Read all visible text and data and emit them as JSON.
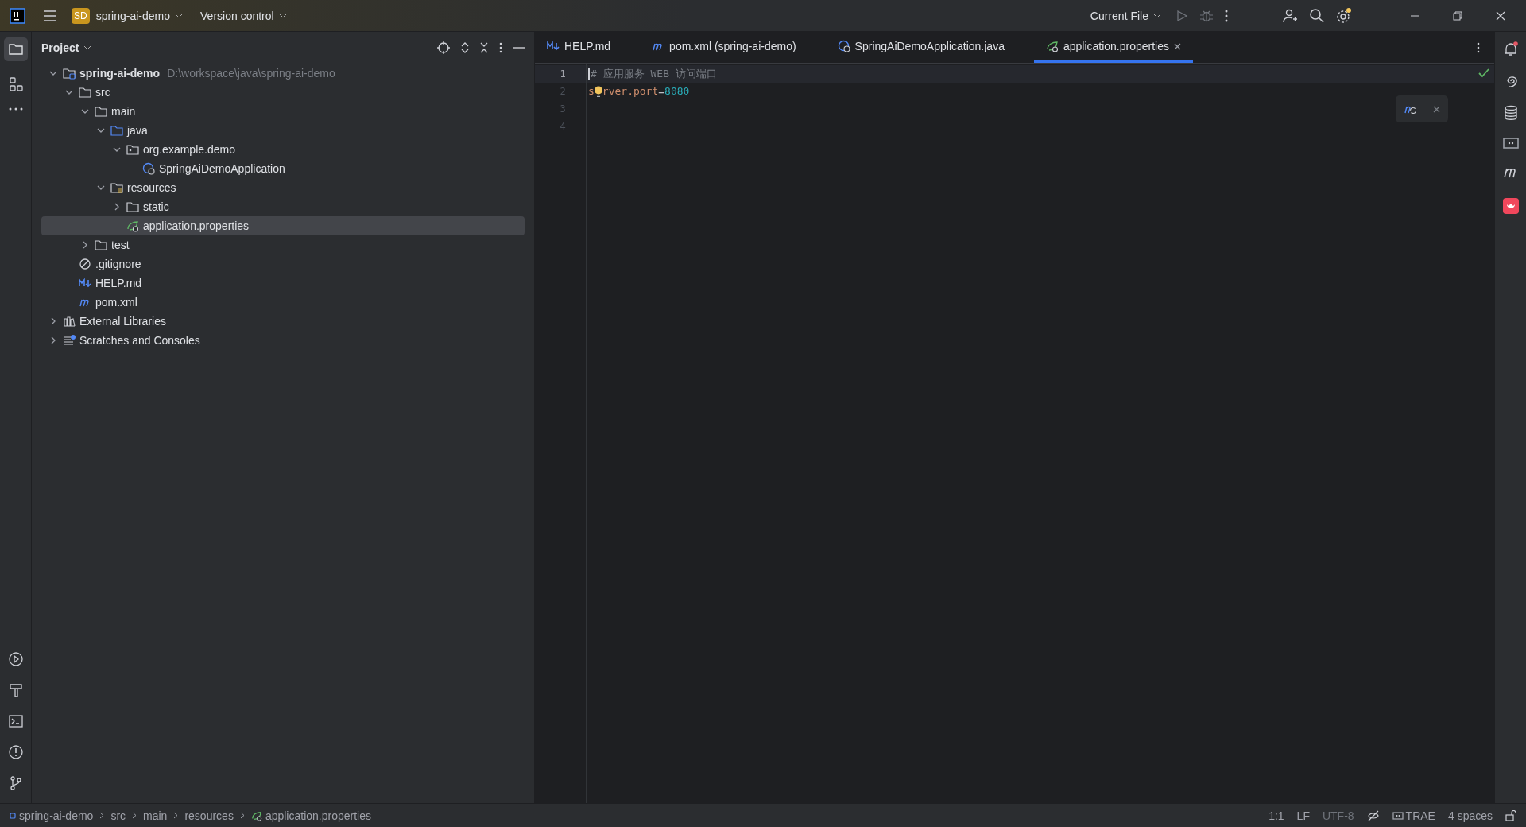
{
  "title_bar": {
    "project_badge": "SD",
    "project_name": "spring-ai-demo",
    "vcs_menu": "Version control",
    "run_config": "Current File"
  },
  "project_panel": {
    "title": "Project",
    "tree": [
      {
        "kind": "project",
        "label": "spring-ai-demo",
        "path": "D:\\workspace\\java\\spring-ai-demo",
        "expanded": true,
        "selected": false,
        "children": [
          {
            "kind": "folder",
            "label": "src",
            "expanded": true,
            "selected": false,
            "children": [
              {
                "kind": "folder",
                "label": "main",
                "expanded": true,
                "selected": false,
                "children": [
                  {
                    "kind": "source-folder",
                    "label": "java",
                    "expanded": true,
                    "selected": false,
                    "children": [
                      {
                        "kind": "package",
                        "label": "org.example.demo",
                        "expanded": true,
                        "selected": false,
                        "children": [
                          {
                            "kind": "class",
                            "label": "SpringAiDemoApplication",
                            "selected": false
                          }
                        ]
                      }
                    ]
                  },
                  {
                    "kind": "resources-folder",
                    "label": "resources",
                    "expanded": true,
                    "selected": false,
                    "children": [
                      {
                        "kind": "folder",
                        "label": "static",
                        "expanded": false,
                        "selected": false
                      },
                      {
                        "kind": "properties",
                        "label": "application.properties",
                        "selected": true
                      }
                    ]
                  }
                ]
              },
              {
                "kind": "folder",
                "label": "test",
                "expanded": false,
                "selected": false
              }
            ]
          },
          {
            "kind": "ignore",
            "label": ".gitignore",
            "selected": false
          },
          {
            "kind": "markdown",
            "label": "HELP.md",
            "selected": false
          },
          {
            "kind": "maven",
            "label": "pom.xml",
            "selected": false
          }
        ]
      },
      {
        "kind": "libraries",
        "label": "External Libraries",
        "expanded": false,
        "selected": false
      },
      {
        "kind": "scratches",
        "label": "Scratches and Consoles",
        "expanded": false,
        "selected": false
      }
    ]
  },
  "editor": {
    "tabs": [
      {
        "kind": "markdown",
        "label": "HELP.md",
        "selected": false
      },
      {
        "kind": "maven",
        "label": "pom.xml (spring-ai-demo)",
        "selected": false
      },
      {
        "kind": "class",
        "label": "SpringAiDemoApplication.java",
        "selected": false
      },
      {
        "kind": "properties",
        "label": "application.properties",
        "selected": true
      }
    ],
    "lines": [
      {
        "number": "1",
        "current": true,
        "parts": [
          {
            "kind": "comment",
            "text": "# 应用服务 WEB 访问端口"
          }
        ]
      },
      {
        "number": "2",
        "current": false,
        "parts": [
          {
            "kind": "key",
            "text": "s"
          },
          {
            "kind": "bulb"
          },
          {
            "kind": "key",
            "text": "rver.port"
          },
          {
            "kind": "op",
            "text": "="
          },
          {
            "kind": "value",
            "text": "8080"
          }
        ]
      },
      {
        "number": "3",
        "current": false
      },
      {
        "number": "4",
        "current": false
      }
    ]
  },
  "status_bar": {
    "breadcrumbs": [
      {
        "kind": "module",
        "label": "spring-ai-demo"
      },
      {
        "kind": "plain",
        "label": "src"
      },
      {
        "kind": "plain",
        "label": "main"
      },
      {
        "kind": "plain",
        "label": "resources"
      },
      {
        "kind": "properties",
        "label": "application.properties"
      }
    ],
    "position": "1:1",
    "line_separator": "LF",
    "encoding": "UTF-8",
    "plugin": "TRAE",
    "indent": "4 spaces"
  }
}
